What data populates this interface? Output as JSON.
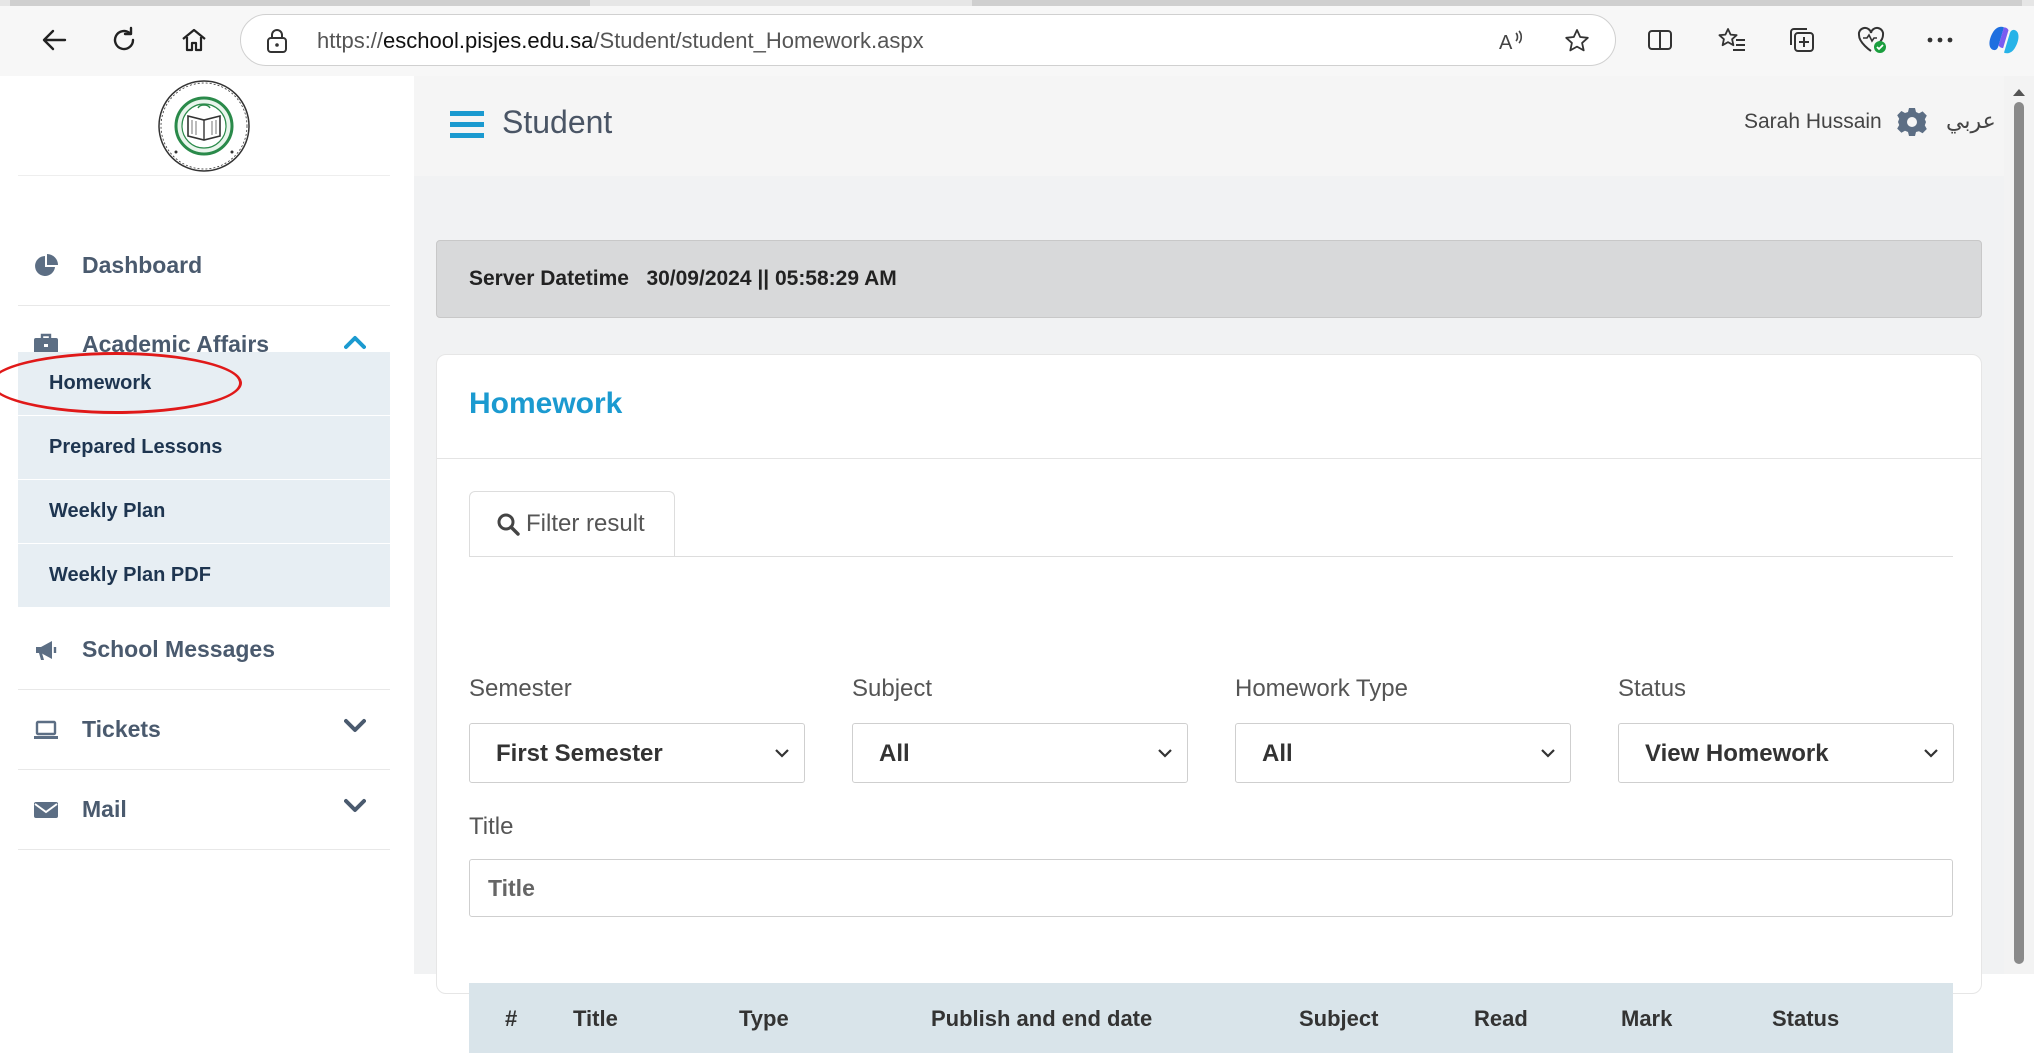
{
  "browser": {
    "url_prefix": "https://",
    "url_host": "eschool.pisjes.edu.sa",
    "url_path": "/Student/student_Homework.aspx"
  },
  "sidebar": {
    "items": [
      {
        "label": "Dashboard",
        "icon": "pie-chart-icon"
      },
      {
        "label": "Academic Affairs",
        "icon": "briefcase-icon",
        "expanded": true
      },
      {
        "label": "School Messages",
        "icon": "megaphone-icon"
      },
      {
        "label": "Tickets",
        "icon": "laptop-icon"
      },
      {
        "label": "Mail",
        "icon": "envelope-icon"
      }
    ],
    "subitems": [
      {
        "label": "Homework",
        "active": true
      },
      {
        "label": "Prepared Lessons"
      },
      {
        "label": "Weekly Plan"
      },
      {
        "label": "Weekly Plan PDF"
      }
    ]
  },
  "topbar": {
    "title": "Student",
    "user_name": "Sarah Hussain",
    "language_toggle": "عربي"
  },
  "server": {
    "label": "Server Datetime",
    "value": "30/09/2024 || 05:58:29 AM"
  },
  "homework": {
    "title": "Homework",
    "filter_tab": "Filter result",
    "filters": {
      "semester_label": "Semester",
      "semester_value": "First Semester",
      "subject_label": "Subject",
      "subject_value": "All",
      "type_label": "Homework Type",
      "type_value": "All",
      "status_label": "Status",
      "status_value": "View Homework",
      "title_label": "Title",
      "title_placeholder": "Title"
    },
    "table": {
      "columns": [
        "#",
        "Title",
        "Type",
        "Publish and end date",
        "Subject",
        "Read",
        "Mark",
        "Status"
      ]
    }
  },
  "colors": {
    "accent": "#1b9ad0",
    "annotation": "#e01919",
    "sidebar_sub_bg": "#e7eef3",
    "table_header_bg": "#d9e4ea"
  }
}
